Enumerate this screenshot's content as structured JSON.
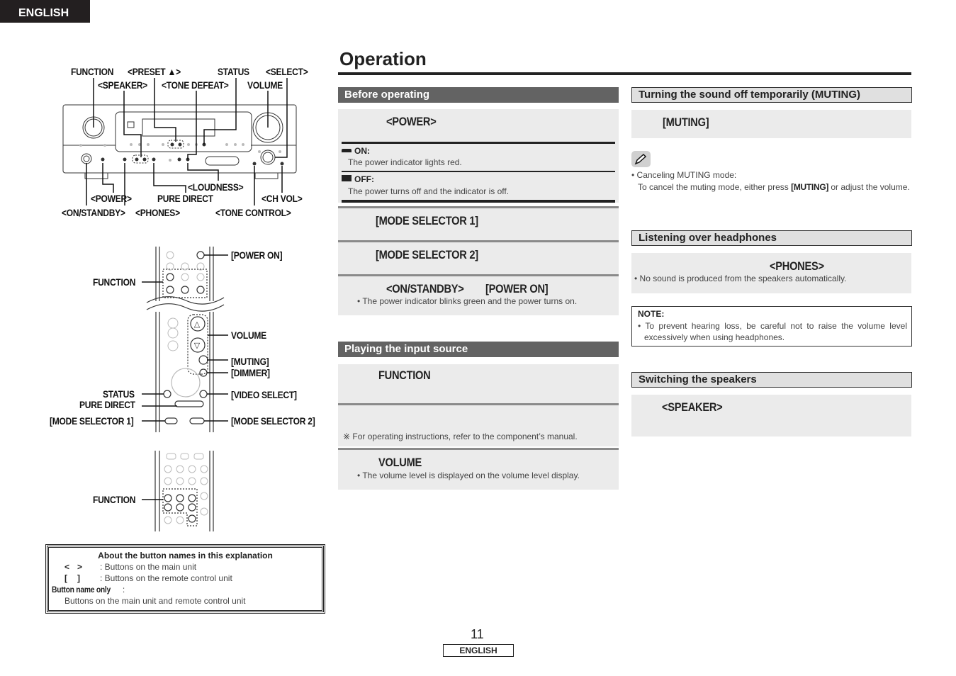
{
  "header": {
    "language_tab": "ENGLISH"
  },
  "page": {
    "title": "Operation",
    "page_number": "11",
    "footer_language": "ENGLISH"
  },
  "diagrams": {
    "main_unit": {
      "labels_top": [
        "FUNCTION",
        "<PRESET ▲>",
        "STATUS",
        "<SELECT>",
        "<SPEAKER>",
        "<TONE DEFEAT>",
        "VOLUME"
      ],
      "labels_bottom": [
        "<LOUDNESS>",
        "<POWER>",
        "PURE DIRECT",
        "<CH VOL>",
        "<ON/STANDBY>",
        "<PHONES>",
        "<TONE CONTROL>"
      ]
    },
    "remote_upper": {
      "labels_right": [
        "[POWER ON]",
        "VOLUME",
        "[MUTING]",
        "[DIMMER]",
        "[VIDEO SELECT]",
        "[MODE SELECTOR 2]"
      ],
      "labels_left": [
        "FUNCTION",
        "STATUS",
        "PURE DIRECT",
        "[MODE SELECTOR 1]"
      ]
    },
    "remote_lower": {
      "labels_left": [
        "FUNCTION"
      ]
    }
  },
  "legend": {
    "title": "About the button names in this explanation",
    "rows": [
      {
        "symbol_open": "<",
        "symbol_close": ">",
        "desc": ": Buttons on the main unit"
      },
      {
        "symbol_open": "[",
        "symbol_close": "]",
        "desc": ": Buttons on the remote control unit"
      }
    ],
    "button_name_only_label": "Button name only",
    "button_name_only_colon": " :",
    "button_name_only_desc": "Buttons on the main unit and remote control unit"
  },
  "sections": {
    "before_operating": {
      "title": "Before operating",
      "step1": "<POWER>",
      "on_label": "ON:",
      "on_desc": "The power indicator lights red.",
      "off_label": "OFF:",
      "off_desc": "The power turns off and the indicator is off.",
      "step2": "[MODE SELECTOR 1]",
      "step3": "[MODE SELECTOR 2]",
      "step4a": "<ON/STANDBY>",
      "step4b": "[POWER ON]",
      "step4_note": "• The power indicator blinks green and the power turns on."
    },
    "playing": {
      "title": "Playing the input source",
      "step1": "FUNCTION",
      "step2_note": "※ For operating instructions, refer to the component’s manual.",
      "step3": "VOLUME",
      "step3_note": "• The volume level is displayed on the volume level display."
    },
    "muting": {
      "title": "Turning the sound off temporarily (MUTING)",
      "step1": "[MUTING]",
      "bullet_title": "• Canceling MUTING mode:",
      "desc_pre": "To cancel the muting mode, either press ",
      "desc_bold": "[MUTING]",
      "desc_post": " or adjust the volume."
    },
    "headphones": {
      "title": "Listening over headphones",
      "step1": "<PHONES>",
      "note": "• No sound is produced from the speakers automatically.",
      "warning_title": "NOTE:",
      "warning_text": "• To prevent hearing loss, be careful not to raise the volume level excessively when using headphones."
    },
    "speakers": {
      "title": "Switching the speakers",
      "step1": "<SPEAKER>"
    }
  }
}
